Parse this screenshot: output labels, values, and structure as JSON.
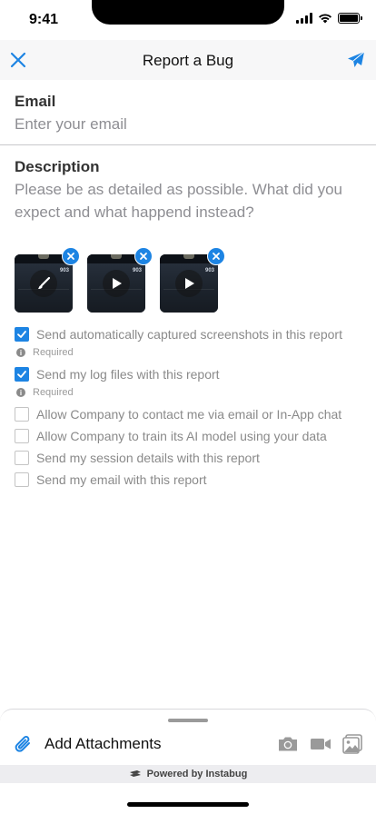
{
  "status_bar": {
    "time": "9:41"
  },
  "nav": {
    "title": "Report a Bug",
    "close_icon": "close-icon",
    "send_icon": "send-icon"
  },
  "email": {
    "label": "Email",
    "placeholder": "Enter your email"
  },
  "description": {
    "label": "Description",
    "placeholder": "Please be as detailed as possible. What did you expect and what happend instead?"
  },
  "attachments": [
    {
      "kind": "screenshot",
      "overlay_icon": "brush-icon",
      "preview_number": "903"
    },
    {
      "kind": "video",
      "overlay_icon": "play-icon",
      "preview_number": "903"
    },
    {
      "kind": "video",
      "overlay_icon": "play-icon",
      "preview_number": "903"
    }
  ],
  "options": [
    {
      "label": "Send automatically captured screenshots in this report",
      "checked": true,
      "note": "Required"
    },
    {
      "label": "Send my log files with this report",
      "checked": true,
      "note": "Required"
    },
    {
      "label": "Allow Company to contact me via email or In-App chat",
      "checked": false
    },
    {
      "label": "Allow Company to train its AI model using your data",
      "checked": false
    },
    {
      "label": "Send my session details with this report",
      "checked": false
    },
    {
      "label": "Send my email with this report",
      "checked": false
    }
  ],
  "bottom": {
    "attach_label": "Add Attachments",
    "icons": [
      "camera-icon",
      "video-camera-icon",
      "gallery-icon"
    ],
    "powered_by": "Powered by Instabug"
  },
  "colors": {
    "accent": "#1d84e3",
    "nav_bg": "#f7f7f8",
    "placeholder": "#8e8e93"
  }
}
